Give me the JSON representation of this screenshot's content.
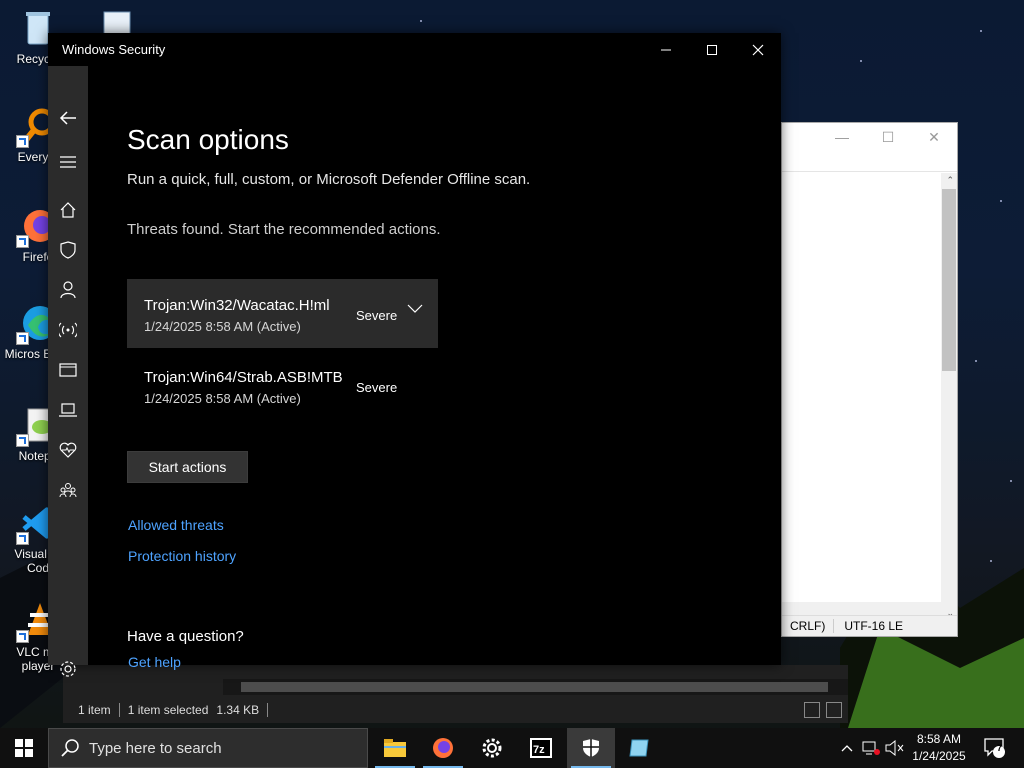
{
  "desktop": {
    "icons": [
      {
        "label": "Recycle",
        "icon": "recycle-bin-icon"
      },
      {
        "label": "Everyth",
        "icon": "everything-search-icon"
      },
      {
        "label": "Firefo",
        "icon": "firefox-icon"
      },
      {
        "label": "Micros Edge",
        "icon": "edge-icon"
      },
      {
        "label": "Notepa",
        "icon": "notepad-plus-icon"
      },
      {
        "label": "Visual St Cod",
        "icon": "vscode-icon"
      },
      {
        "label": "VLC me player",
        "icon": "vlc-icon"
      }
    ]
  },
  "notepad": {
    "status_encoding_eol": "CRLF)",
    "status_encoding": "UTF-16 LE"
  },
  "explorer": {
    "item_count": "1 item",
    "selected": "1 item selected",
    "size": "1.34 KB"
  },
  "winsec": {
    "title": "Windows Security",
    "heading": "Scan options",
    "subtitle": "Run a quick, full, custom, or Microsoft Defender Offline scan.",
    "threats_message": "Threats found. Start the recommended actions.",
    "threats": [
      {
        "name": "Trojan:Win32/Wacatac.H!ml",
        "date": "1/24/2025 8:58 AM (Active)",
        "severity": "Severe",
        "selected": true
      },
      {
        "name": "Trojan:Win64/Strab.ASB!MTB",
        "date": "1/24/2025 8:58 AM (Active)",
        "severity": "Severe",
        "selected": false
      }
    ],
    "start_actions": "Start actions",
    "allowed_threats": "Allowed threats",
    "protection_history": "Protection history",
    "question": "Have a question?",
    "get_help": "Get help",
    "rail_icons": [
      "back-arrow-icon",
      "hamburger-menu-icon",
      "home-icon",
      "shield-icon",
      "account-icon",
      "firewall-network-icon",
      "app-browser-control-icon",
      "device-security-icon",
      "device-health-icon",
      "family-options-icon",
      "settings-gear-icon"
    ]
  },
  "taskbar": {
    "search_placeholder": "Type here to search",
    "time": "8:58 AM",
    "date": "1/24/2025",
    "notification_count": "7",
    "apps": [
      "file-explorer-icon",
      "firefox-icon",
      "settings-gear-icon",
      "7zip-icon",
      "windows-security-icon",
      "notepad-icon"
    ]
  }
}
